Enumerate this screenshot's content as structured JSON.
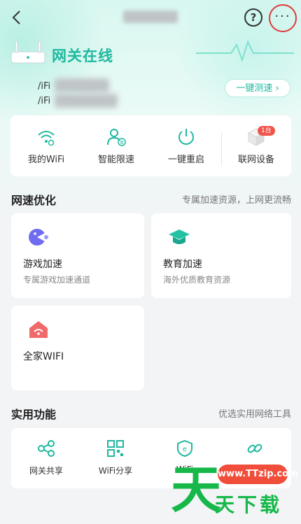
{
  "status": {
    "title": "网关在线"
  },
  "wifi": {
    "line1_prefix": "/iFi",
    "line2_prefix": "/iFi"
  },
  "actions": {
    "speed_test": "一键测速 ›"
  },
  "quick": {
    "items": [
      {
        "label": "我的WiFi",
        "icon": "wifi-settings-icon"
      },
      {
        "label": "智能限速",
        "icon": "user-speed-limit-icon"
      },
      {
        "label": "一键重启",
        "icon": "power-icon"
      },
      {
        "label": "联网设备",
        "icon": "devices-icon"
      }
    ],
    "device_badge": "1台"
  },
  "speed_section": {
    "title": "网速优化",
    "subtitle": "专属加速资源，上网更流畅",
    "cards": [
      {
        "title": "游戏加速",
        "subtitle": "专属游戏加速通道",
        "icon": "game-icon"
      },
      {
        "title": "教育加速",
        "subtitle": "海外优质教育资源",
        "icon": "education-icon"
      },
      {
        "title": "全家WIFI",
        "subtitle": "",
        "icon": "home-wifi-icon"
      }
    ]
  },
  "tools_section": {
    "title": "实用功能",
    "subtitle": "优选实用网络工具",
    "items": [
      {
        "label": "网关共享",
        "icon": "share-icon"
      },
      {
        "label": "WiFi分享",
        "icon": "qr-code-icon"
      },
      {
        "label": "WiFi",
        "icon": "wifi-shield-icon"
      },
      {
        "label": "",
        "icon": "link-icon"
      }
    ]
  },
  "watermark": {
    "url": "www.TTzip.com",
    "text": "天下载",
    "big": "天"
  },
  "colors": {
    "accent": "#1fb8a0",
    "badge": "#f0554a",
    "highlight": "#e23a3a"
  }
}
